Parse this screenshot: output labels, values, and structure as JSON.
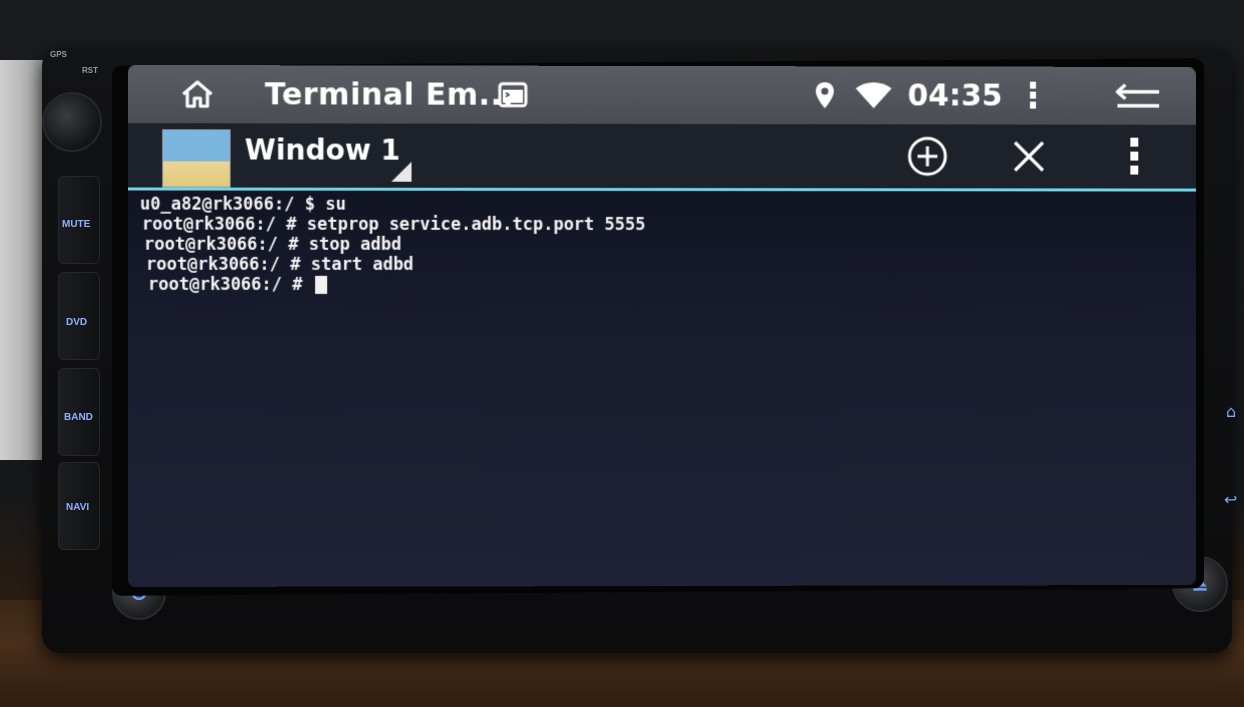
{
  "statusbar": {
    "app_title": "Terminal Em...",
    "clock": "04:35"
  },
  "actionbar": {
    "window_title": "Window 1"
  },
  "terminal": {
    "lines": [
      "u0_a82@rk3066:/ $ su",
      "root@rk3066:/ # setprop service.adb.tcp.port 5555",
      "root@rk3066:/ # stop adbd",
      "root@rk3066:/ # start adbd"
    ],
    "prompt": "root@rk3066:/ # "
  },
  "hardware": {
    "gps_label": "GPS",
    "rst_label": "RST",
    "mute_label": "MUTE",
    "dvd_label": "DVD",
    "band_label": "BAND",
    "navi_label": "NAVI"
  },
  "icons": {
    "home": "home-icon",
    "terminal": "terminal-icon",
    "location": "location-pin-icon",
    "wifi": "wifi-icon",
    "overflow": "overflow-menu-icon",
    "back": "back-icon",
    "add": "add-circle-icon",
    "close": "close-icon",
    "power": "power-icon",
    "eject": "eject-icon"
  },
  "colors": {
    "accent": "#6fd6e6",
    "statusbar": "#4e5157",
    "terminal_bg": "#161a28",
    "hw_label": "#8fb2ff"
  }
}
